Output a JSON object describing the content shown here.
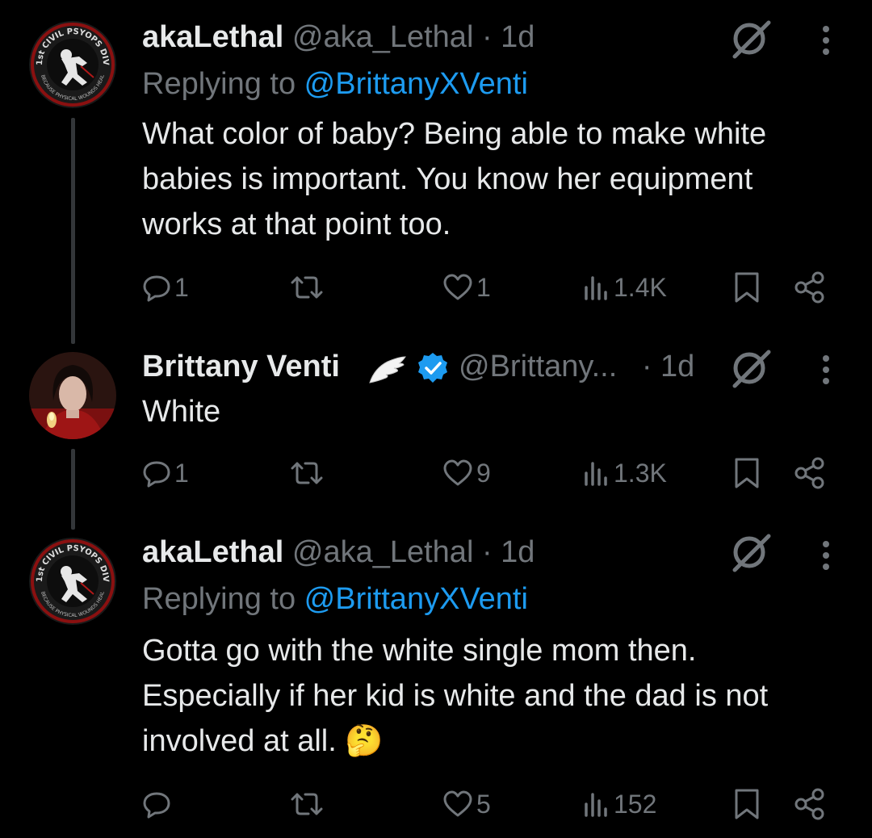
{
  "tweets": [
    {
      "display_name": "akaLethal",
      "handle": "@aka_Lethal",
      "time": "· 1d",
      "replying_prefix": "Replying to ",
      "replying_to": "@BrittanyXVenti",
      "text": "What color of baby? Being able to make white babies is important. You know her equipment works at that point too.",
      "replies": "1",
      "reposts": "",
      "likes": "1",
      "views": "1.4K",
      "avatar_text_top": "1st CIVIL PSYOPS DIV",
      "avatar_text_bottom": "BECAUSE PHYSICAL WOUNDS HEAL"
    },
    {
      "display_name": "Brittany Venti",
      "handle": "@Brittany...",
      "time": "· 1d",
      "text": "White",
      "replies": "1",
      "reposts": "",
      "likes": "9",
      "views": "1.3K"
    },
    {
      "display_name": "akaLethal",
      "handle": "@aka_Lethal",
      "time": "· 1d",
      "replying_prefix": "Replying to ",
      "replying_to": "@BrittanyXVenti",
      "text": "Gotta go with the white single mom then. Especially if her kid is white and the dad is not involved at all. 🤔",
      "replies": "",
      "reposts": "",
      "likes": "5",
      "views": "152",
      "avatar_text_top": "1st CIVIL PSYOPS DIV",
      "avatar_text_bottom": "BECAUSE PHYSICAL WOUNDS HEAL"
    }
  ],
  "colors": {
    "background": "#000000",
    "text": "#e7e9ea",
    "muted": "#71767b",
    "link": "#1d9bf0",
    "verified": "#1d9bf0"
  },
  "icons": [
    "reply-icon",
    "repost-icon",
    "like-icon",
    "views-icon",
    "bookmark-icon",
    "share-icon",
    "grok-icon",
    "more-icon",
    "verified-badge-icon",
    "wings-emoji-icon"
  ]
}
